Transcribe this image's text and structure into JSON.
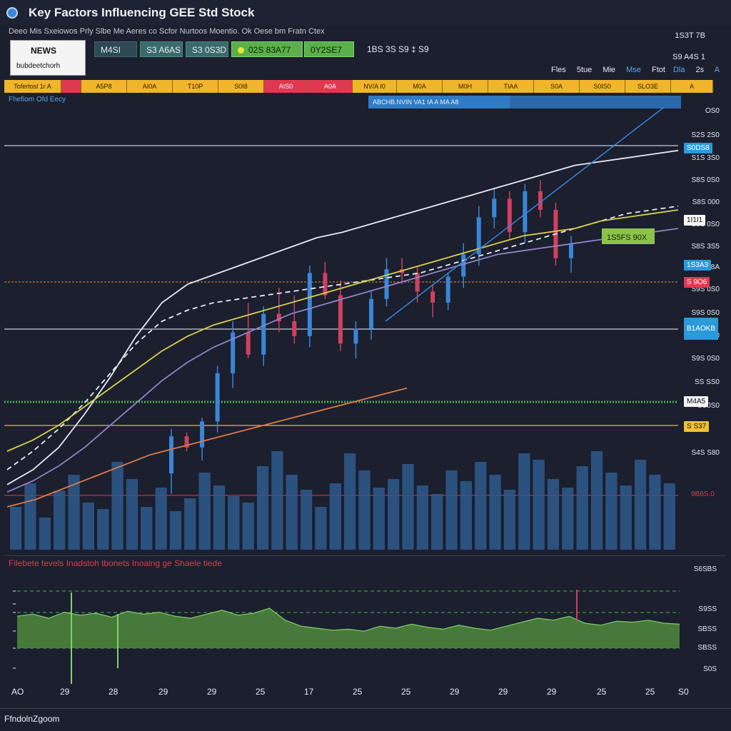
{
  "window": {
    "title": "Key Factors Influencing GEE Std Stock"
  },
  "header": {
    "subtitle": "Deeo  Mis  Sxeiowos  Prly  Slbe  Me Aeres  co  Scfor  Nurtoos  Moentio.  Ok  Oese  bm  Fratn  Ctex",
    "news_title": "NEWS",
    "news_sub": "bubdeetchorh",
    "buttons": [
      "M4SI",
      "S3 A6AS",
      "S3 0S3D",
      "02S 83A77",
      "0Y2SE7"
    ],
    "readout": "1BS 3S S9 ‡ S9",
    "right_top": [
      "1S3T 7B",
      "S9 A4S 1"
    ],
    "menu": [
      "Fles",
      "5tue",
      "Mie",
      "Mse",
      "Ftot",
      "Dla",
      "2s",
      "A"
    ]
  },
  "tabs": [
    {
      "label": "Tofertosl 1r A",
      "color": "#f1b52b"
    },
    {
      "label": "",
      "color": "#e0394f"
    },
    {
      "label": "A5P8",
      "color": "#f1b52b"
    },
    {
      "label": "AI0A",
      "color": "#f1b52b"
    },
    {
      "label": "T10P",
      "color": "#f1b52b"
    },
    {
      "label": "S0I8",
      "color": "#f1b52b"
    },
    {
      "label": "AIS0",
      "color": "#e0394f"
    },
    {
      "label": "A0A",
      "color": "#e0394f"
    },
    {
      "label": "NV/A I0",
      "color": "#f1b52b"
    },
    {
      "label": "M0A",
      "color": "#f1b52b"
    },
    {
      "label": "M0H",
      "color": "#f1b52b"
    },
    {
      "label": "TIAA",
      "color": "#f1b52b"
    },
    {
      "label": "S0A",
      "color": "#f1b52b"
    },
    {
      "label": "S0IS0",
      "color": "#f1b52b"
    },
    {
      "label": "SLO3E",
      "color": "#f1b52b"
    },
    {
      "label": "A",
      "color": "#f1b52b"
    }
  ],
  "chart_label": "Fhefiom Ofd Eecy",
  "banner": "ABCHB.NVIN VA1 IA  A  MA  A8",
  "colors": {
    "up": "#3a86d8",
    "down": "#d0405f",
    "bg": "#1b1f2e",
    "accent": "#f1b52b",
    "osc": "#5c9e48"
  },
  "right_tags": [
    {
      "label": "S0DS8",
      "style": "blue"
    },
    {
      "label": "1I1I1",
      "style": "white"
    },
    {
      "label": "1S3A3",
      "style": "blue"
    },
    {
      "label": "S 9O6",
      "style": "red"
    },
    {
      "label": "B1AOKB",
      "style": "blue"
    },
    {
      "label": "M4A5",
      "style": "white"
    },
    {
      "label": "S S37",
      "style": "yellow"
    },
    {
      "label": "9B6S.0",
      "style": "none"
    }
  ],
  "annotation": "1S5FS 90X",
  "lower": {
    "title": "Filebete tevels Inadstoh tbonets Inoaing ge",
    "title_red": "Shaele tiede",
    "y_labels": [
      "S6SBS",
      "S9SS",
      "SBSS",
      "SBSS",
      "S0S"
    ],
    "footer": "FfndolnZgoom"
  },
  "chart_data": [
    {
      "type": "candlestick",
      "title": "",
      "y_tick_labels": [
        "OS0",
        "S2S 2S0",
        "S1S 3S0",
        "S8S 0S0",
        "S8S 000",
        "S8S 0S0",
        "S8S 3S5",
        "SIA S8A",
        "S9S 0S0",
        "S9S 0S0",
        "S9S 0S0",
        "S9S 0S0",
        "SS SS0",
        "SS0S0",
        "S4S S80"
      ],
      "candles": [
        {
          "o": 58,
          "h": 82,
          "l": 47,
          "c": 78
        },
        {
          "o": 78,
          "h": 80,
          "l": 70,
          "c": 72
        },
        {
          "o": 72,
          "h": 88,
          "l": 65,
          "c": 86
        },
        {
          "o": 86,
          "h": 116,
          "l": 80,
          "c": 112
        },
        {
          "o": 112,
          "h": 140,
          "l": 104,
          "c": 134
        },
        {
          "o": 134,
          "h": 150,
          "l": 120,
          "c": 122
        },
        {
          "o": 122,
          "h": 148,
          "l": 116,
          "c": 144
        },
        {
          "o": 144,
          "h": 158,
          "l": 134,
          "c": 140
        },
        {
          "o": 140,
          "h": 154,
          "l": 128,
          "c": 132
        },
        {
          "o": 132,
          "h": 170,
          "l": 126,
          "c": 166
        },
        {
          "o": 166,
          "h": 172,
          "l": 152,
          "c": 154
        },
        {
          "o": 154,
          "h": 162,
          "l": 124,
          "c": 128
        },
        {
          "o": 128,
          "h": 140,
          "l": 120,
          "c": 136
        },
        {
          "o": 136,
          "h": 156,
          "l": 130,
          "c": 152
        },
        {
          "o": 152,
          "h": 174,
          "l": 148,
          "c": 168
        },
        {
          "o": 168,
          "h": 174,
          "l": 160,
          "c": 166
        },
        {
          "o": 166,
          "h": 170,
          "l": 150,
          "c": 156
        },
        {
          "o": 156,
          "h": 160,
          "l": 142,
          "c": 150
        },
        {
          "o": 150,
          "h": 166,
          "l": 146,
          "c": 164
        },
        {
          "o": 164,
          "h": 182,
          "l": 158,
          "c": 176
        },
        {
          "o": 176,
          "h": 202,
          "l": 170,
          "c": 196
        },
        {
          "o": 196,
          "h": 212,
          "l": 190,
          "c": 206
        },
        {
          "o": 206,
          "h": 210,
          "l": 184,
          "c": 188
        },
        {
          "o": 188,
          "h": 214,
          "l": 182,
          "c": 210
        },
        {
          "o": 210,
          "h": 216,
          "l": 196,
          "c": 200
        },
        {
          "o": 200,
          "h": 204,
          "l": 170,
          "c": 174
        },
        {
          "o": 174,
          "h": 186,
          "l": 166,
          "c": 182
        }
      ],
      "moving_averages": [
        {
          "color": "#e8eaf0",
          "style": "solid",
          "values": [
            52,
            60,
            72,
            90,
            110,
            132,
            150,
            160,
            165,
            170,
            175,
            180,
            185,
            188,
            192,
            196,
            200,
            204,
            208,
            212,
            216,
            220,
            224,
            226,
            228,
            230,
            232
          ]
        },
        {
          "color": "#e8eaf0",
          "style": "dashed",
          "values": [
            60,
            70,
            82,
            96,
            112,
            128,
            140,
            146,
            150,
            152,
            154,
            156,
            158,
            160,
            162,
            164,
            166,
            170,
            174,
            178,
            182,
            186,
            190,
            194,
            198,
            200,
            202
          ]
        },
        {
          "color": "#d9cf4a",
          "style": "solid",
          "values": [
            70,
            76,
            84,
            94,
            104,
            114,
            124,
            132,
            138,
            142,
            146,
            150,
            154,
            158,
            162,
            166,
            170,
            174,
            178,
            182,
            186,
            188,
            190,
            194,
            196,
            198,
            200
          ]
        },
        {
          "color": "#9083c7",
          "style": "solid",
          "values": [
            48,
            54,
            62,
            72,
            84,
            96,
            108,
            118,
            126,
            132,
            138,
            144,
            148,
            152,
            156,
            160,
            164,
            168,
            172,
            176,
            178,
            180,
            182,
            184,
            186,
            188,
            190
          ]
        },
        {
          "color": "#e07a45",
          "style": "solid",
          "values": [
            40,
            44,
            50,
            56,
            62,
            68,
            72,
            76,
            80,
            84,
            88,
            92,
            96,
            100,
            104
          ]
        }
      ],
      "volume": [
        40,
        62,
        30,
        55,
        70,
        44,
        38,
        82,
        66,
        40,
        58,
        36,
        48,
        72,
        60,
        50,
        44,
        78,
        92,
        70,
        56,
        40,
        62,
        90,
        74,
        58,
        66,
        80,
        60,
        52,
        74,
        64,
        82,
        70,
        56,
        90,
        84,
        66,
        58,
        78,
        92,
        72,
        60,
        84,
        70,
        62
      ],
      "y_range": [
        40,
        240
      ]
    },
    {
      "type": "area",
      "title": "Filebete tevels Inadstoh tbonets Inoaing ge",
      "x_tick_labels": [
        "AO",
        "29",
        "28",
        "29",
        "29",
        "25",
        "17",
        "25",
        "25",
        "29",
        "29",
        "29",
        "25",
        "25",
        "S0"
      ],
      "y_tick_labels": [
        "S6SBS",
        "S9SS",
        "SBSS",
        "SBSS",
        "S0S"
      ],
      "values": [
        62,
        64,
        60,
        66,
        63,
        65,
        61,
        67,
        64,
        66,
        62,
        60,
        64,
        68,
        63,
        65,
        70,
        58,
        52,
        50,
        48,
        49,
        47,
        52,
        50,
        54,
        51,
        49,
        53,
        50,
        48,
        52,
        56,
        60,
        58,
        62,
        55,
        53,
        57,
        56,
        58,
        55,
        54
      ],
      "y_range": [
        0,
        100
      ]
    }
  ]
}
